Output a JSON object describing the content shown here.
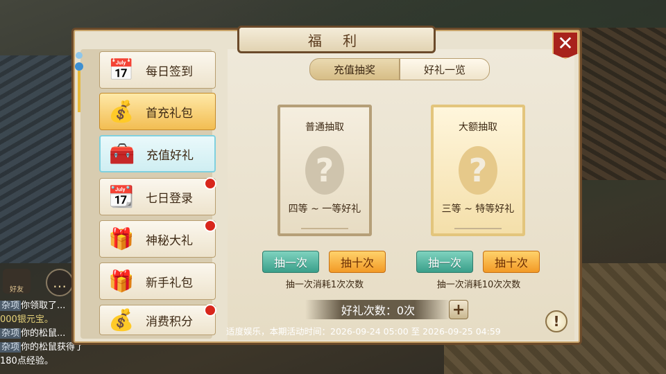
{
  "window": {
    "title": "福 利",
    "close_icon": "close-icon"
  },
  "sidebar": {
    "items": [
      {
        "label": "每日签到",
        "icon": "calendar-30-icon",
        "glyph": "📅",
        "badge": false
      },
      {
        "label": "首充礼包",
        "icon": "gold-bag-icon",
        "glyph": "💰",
        "badge": false
      },
      {
        "label": "充值好礼",
        "icon": "treasure-chest-icon",
        "glyph": "🧰",
        "badge": false
      },
      {
        "label": "七日登录",
        "icon": "calendar-7-icon",
        "glyph": "📆",
        "badge": true
      },
      {
        "label": "神秘大礼",
        "icon": "treasure-chest-gold-icon",
        "glyph": "🎁",
        "badge": true
      },
      {
        "label": "新手礼包",
        "icon": "gift-box-icon",
        "glyph": "🎁",
        "badge": false
      },
      {
        "label": "消费积分",
        "icon": "gold-ingot-icon",
        "glyph": "💰",
        "badge": true
      }
    ]
  },
  "tabs": [
    {
      "label": "充值抽奖"
    },
    {
      "label": "好礼一览"
    }
  ],
  "cards": [
    {
      "title": "普通抽取",
      "subtitle": "四等 ~ 一等好礼",
      "icon": "question-icon"
    },
    {
      "title": "大额抽取",
      "subtitle": "三等 ~ 特等好礼",
      "icon": "question-dragon-icon"
    }
  ],
  "buttons": {
    "draw_once": "抽一次",
    "draw_ten": "抽十次"
  },
  "notes": [
    "抽一次消耗1次次数",
    "抽一次消耗10次次数"
  ],
  "gift_count": "好礼次数：0次",
  "plus": "+",
  "activity": "适度娱乐，本期活动时间：2026-09-24 05:00 至 2026-09-25 04:59",
  "info_icon": "!",
  "chat": {
    "friend_label": "好友",
    "lines": [
      {
        "tag": "杂项",
        "text": "你领取了..."
      },
      {
        "tag": "",
        "text": "000银元宝。"
      },
      {
        "tag": "杂项",
        "text": "你的松鼠..."
      },
      {
        "tag": "杂项",
        "text": "你的松鼠获得了180点经验。"
      }
    ]
  }
}
